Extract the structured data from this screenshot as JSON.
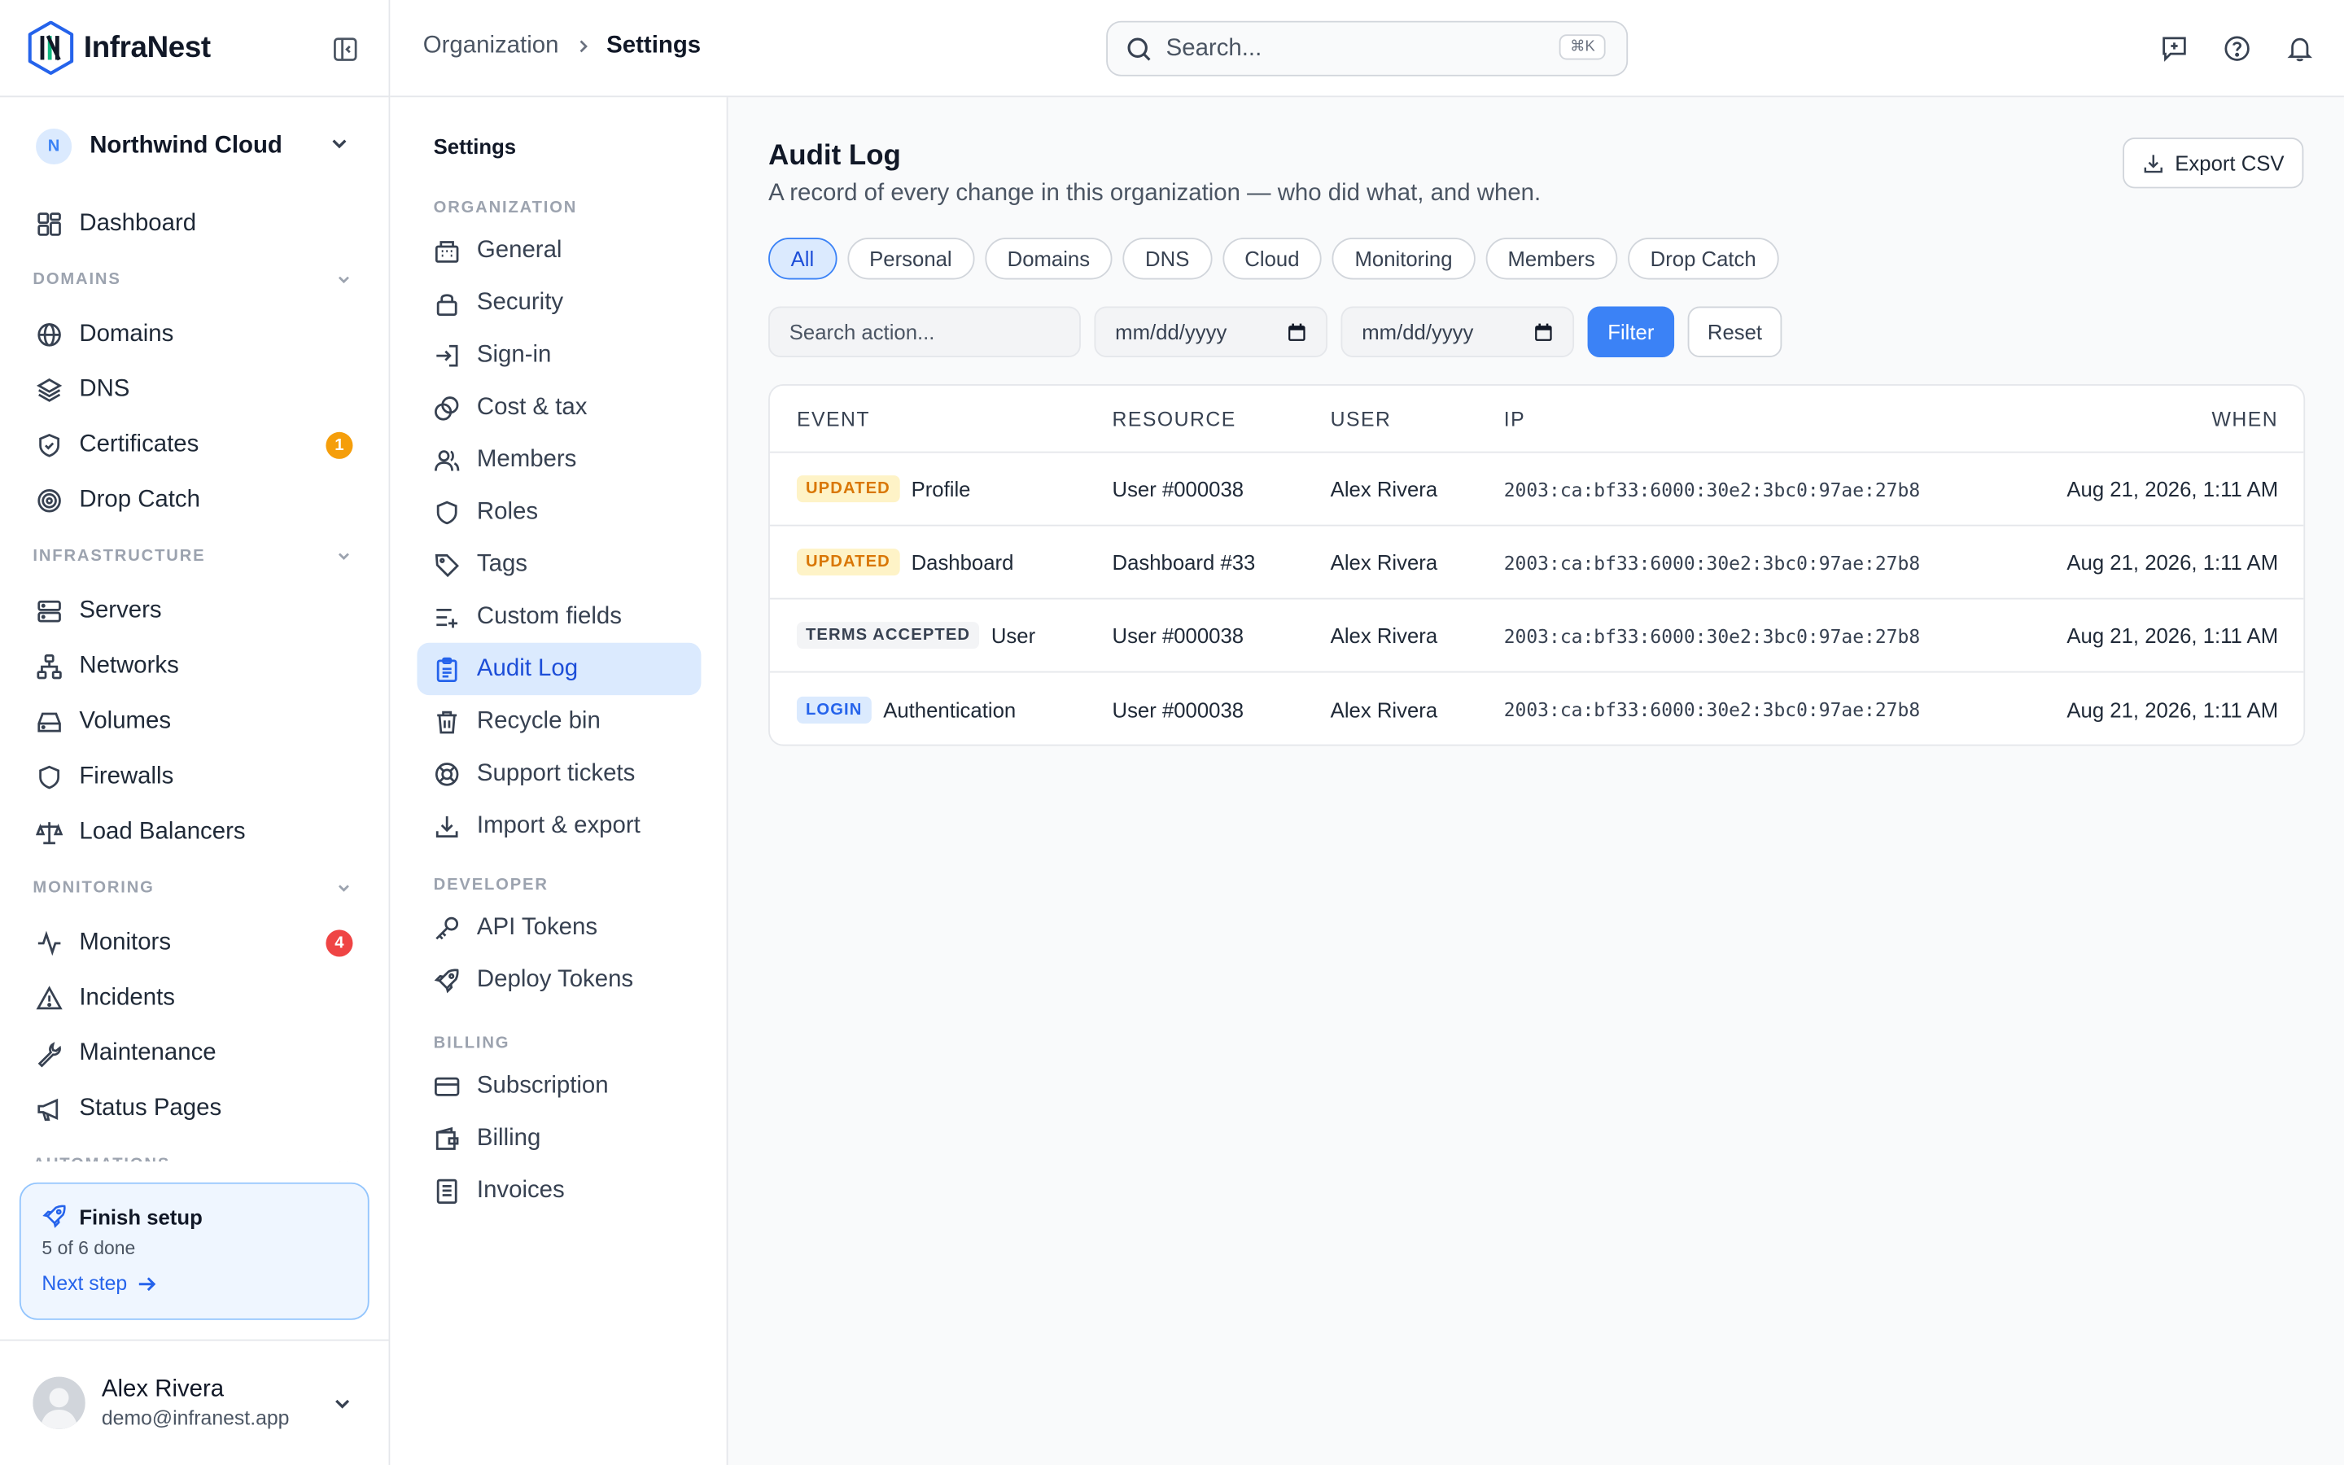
{
  "app": {
    "name": "InfraNest"
  },
  "org": {
    "initial": "N",
    "name": "Northwind Cloud"
  },
  "sidebar": {
    "dashboard": "Dashboard",
    "sections": {
      "domains": "DOMAINS",
      "infrastructure": "INFRASTRUCTURE",
      "monitoring": "MONITORING",
      "automations": "AUTOMATIONS"
    },
    "domains_items": [
      {
        "label": "Domains",
        "icon": "globe-icon"
      },
      {
        "label": "DNS",
        "icon": "layers-icon"
      },
      {
        "label": "Certificates",
        "icon": "shield-check-icon",
        "badge": "1"
      },
      {
        "label": "Drop Catch",
        "icon": "target-icon"
      }
    ],
    "infra_items": [
      {
        "label": "Servers",
        "icon": "server-icon"
      },
      {
        "label": "Networks",
        "icon": "network-icon"
      },
      {
        "label": "Volumes",
        "icon": "hard-drive-icon"
      },
      {
        "label": "Firewalls",
        "icon": "shield-icon"
      },
      {
        "label": "Load Balancers",
        "icon": "scale-icon"
      }
    ],
    "monitoring_items": [
      {
        "label": "Monitors",
        "icon": "activity-icon",
        "badge": "4"
      },
      {
        "label": "Incidents",
        "icon": "alert-triangle-icon"
      },
      {
        "label": "Maintenance",
        "icon": "wrench-icon"
      },
      {
        "label": "Status Pages",
        "icon": "megaphone-icon"
      }
    ],
    "badge_colors": {
      "certificates": "#f59e0b",
      "monitors": "#ef4444"
    }
  },
  "setup": {
    "title": "Finish setup",
    "progress": "5 of 6 done",
    "link": "Next step"
  },
  "user": {
    "name": "Alex Rivera",
    "email": "demo@infranest.app"
  },
  "topbar": {
    "breadcrumb_root": "Organization",
    "breadcrumb_current": "Settings",
    "search_placeholder": "Search...",
    "search_shortcut": "⌘K"
  },
  "settings_nav": {
    "title": "Settings",
    "groups": {
      "organization": "ORGANIZATION",
      "developer": "DEVELOPER",
      "billing": "BILLING"
    },
    "org_items": [
      "General",
      "Security",
      "Sign-in",
      "Cost & tax",
      "Members",
      "Roles",
      "Tags",
      "Custom fields",
      "Audit Log",
      "Recycle bin",
      "Support tickets",
      "Import & export"
    ],
    "dev_items": [
      "API Tokens",
      "Deploy Tokens"
    ],
    "billing_items": [
      "Subscription",
      "Billing",
      "Invoices"
    ],
    "active": "Audit Log"
  },
  "main": {
    "title": "Audit Log",
    "subtitle": "A record of every change in this organization — who did what, and when.",
    "export_label": "Export CSV",
    "chips": [
      "All",
      "Personal",
      "Domains",
      "DNS",
      "Cloud",
      "Monitoring",
      "Members",
      "Drop Catch"
    ],
    "active_chip": "All",
    "search_placeholder": "Search action...",
    "date_from": "mm/dd/yyyy",
    "date_to": "mm/dd/yyyy",
    "filter_label": "Filter",
    "reset_label": "Reset",
    "columns": [
      "EVENT",
      "RESOURCE",
      "USER",
      "IP",
      "WHEN"
    ],
    "rows": [
      {
        "tag": "UPDATED",
        "event": "Profile",
        "resource": "User #000038",
        "user": "Alex Rivera",
        "ip": "2003:ca:bf33:6000:30e2:3bc0:97ae:27b8",
        "when": "Aug 21, 2026, 1:11 AM"
      },
      {
        "tag": "UPDATED",
        "event": "Dashboard",
        "resource": "Dashboard #33",
        "user": "Alex Rivera",
        "ip": "2003:ca:bf33:6000:30e2:3bc0:97ae:27b8",
        "when": "Aug 21, 2026, 1:11 AM"
      },
      {
        "tag": "TERMS ACCEPTED",
        "event": "User",
        "resource": "User #000038",
        "user": "Alex Rivera",
        "ip": "2003:ca:bf33:6000:30e2:3bc0:97ae:27b8",
        "when": "Aug 21, 2026, 1:11 AM"
      },
      {
        "tag": "LOGIN",
        "event": "Authentication",
        "resource": "User #000038",
        "user": "Alex Rivera",
        "ip": "2003:ca:bf33:6000:30e2:3bc0:97ae:27b8",
        "when": "Aug 21, 2026, 1:11 AM"
      }
    ]
  },
  "colors": {
    "accent": "#3b82f6",
    "border": "#e5e7eb",
    "text": "#1f2937"
  }
}
